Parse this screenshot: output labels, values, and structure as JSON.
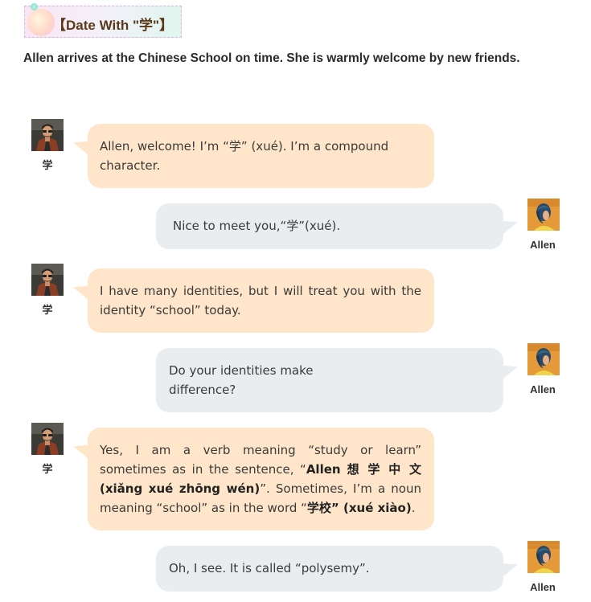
{
  "header": {
    "title": "【Date With \"学\"】",
    "intro": "Allen arrives at the Chinese School on time. She is warmly welcome by new friends."
  },
  "speakers": {
    "xue": {
      "name": "学",
      "avatar_icon": "man-portrait-icon"
    },
    "allen": {
      "name": "Allen",
      "avatar_icon": "woman-portrait-icon"
    }
  },
  "messages": [
    {
      "speaker": "xue",
      "text": " Allen, welcome! I’m “学” (xué). I’m a compound character."
    },
    {
      "speaker": "allen",
      "text": "Nice to meet you,“学”(xué)."
    },
    {
      "speaker": "xue",
      "text": "I have many identities, but I will treat you with the identity “school” today."
    },
    {
      "speaker": "allen",
      "text": "Do your identities make difference?"
    },
    {
      "speaker": "xue",
      "parts": [
        "Yes, I am a verb meaning “study or learn” sometimes as in the sentence, “",
        "Allen 想 学 中 文 (xiǎng xué zhōng wén)",
        "”. Sometimes, I’m a noun meaning “school” as in the word “",
        "学校” (xué xiào)",
        "."
      ]
    },
    {
      "speaker": "allen",
      "text": "Oh, I see. It is called “polysemy”."
    }
  ],
  "colors": {
    "left_bubble": "#ffe6ca",
    "right_bubble": "#eaedf0",
    "title_text": "#5b3a1b"
  }
}
